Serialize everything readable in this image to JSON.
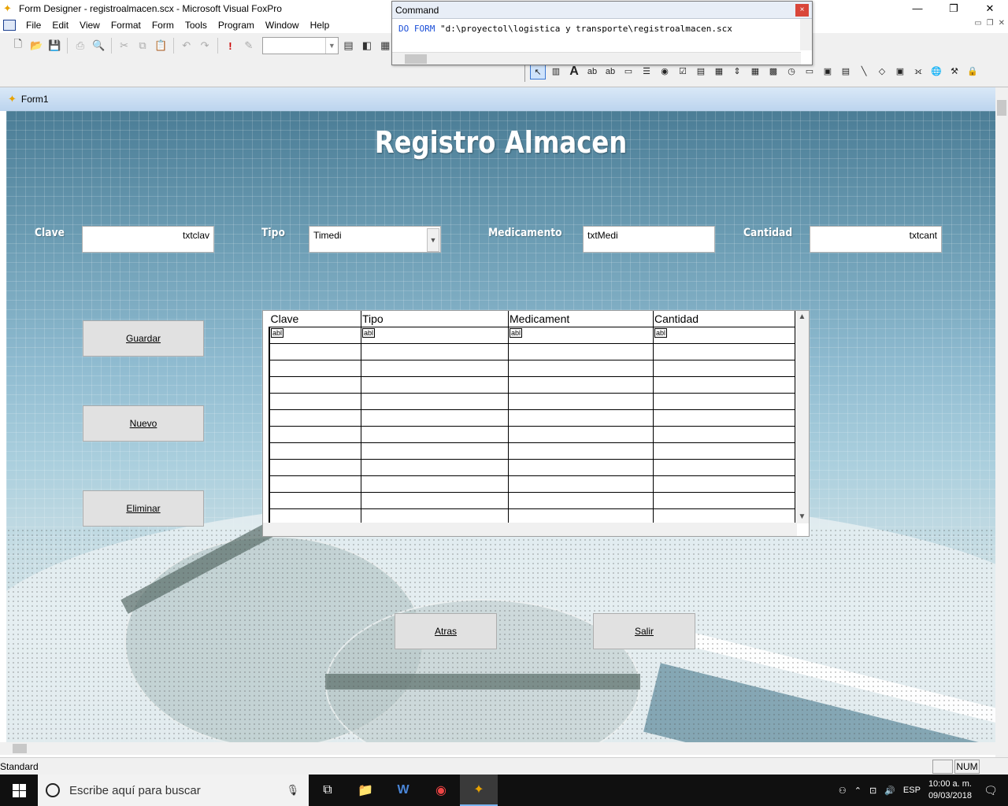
{
  "window": {
    "title": "Form Designer - registroalmacen.scx - Microsoft Visual FoxPro",
    "minimize": "—",
    "maximize": "❐",
    "close": "✕"
  },
  "menu": {
    "items": [
      "File",
      "Edit",
      "View",
      "Format",
      "Form",
      "Tools",
      "Program",
      "Window",
      "Help"
    ]
  },
  "command_window": {
    "title": "Command",
    "close": "×",
    "keyword1": "DO",
    "keyword2": "FORM",
    "argument": "\"d:\\proyectol\\logistica y transporte\\registroalmacen.scx"
  },
  "form_designer": {
    "caption": "Form1",
    "heading": "Registro Almacen",
    "fields": {
      "clave_label": "Clave",
      "clave_value": "txtclav",
      "tipo_label": "Tipo",
      "tipo_value": "Timedi",
      "medicamento_label": "Medicamento",
      "medicamento_value": "txtMedi",
      "cantidad_label": "Cantidad",
      "cantidad_value": "txtcant"
    },
    "buttons": {
      "guardar": "Guardar",
      "nuevo": "Nuevo",
      "eliminar": "Eliminar",
      "atras": "Atras",
      "salir": "Salir"
    },
    "grid": {
      "columns": [
        "Clave",
        "Tipo",
        "Medicament",
        "Cantidad"
      ],
      "textbox_marker": "abl"
    }
  },
  "status": {
    "left": "Standard",
    "num": "NUM"
  },
  "taskbar": {
    "search_placeholder": "Escribe aquí para buscar",
    "language": "ESP",
    "time": "10:00 a. m.",
    "date": "09/03/2018"
  }
}
